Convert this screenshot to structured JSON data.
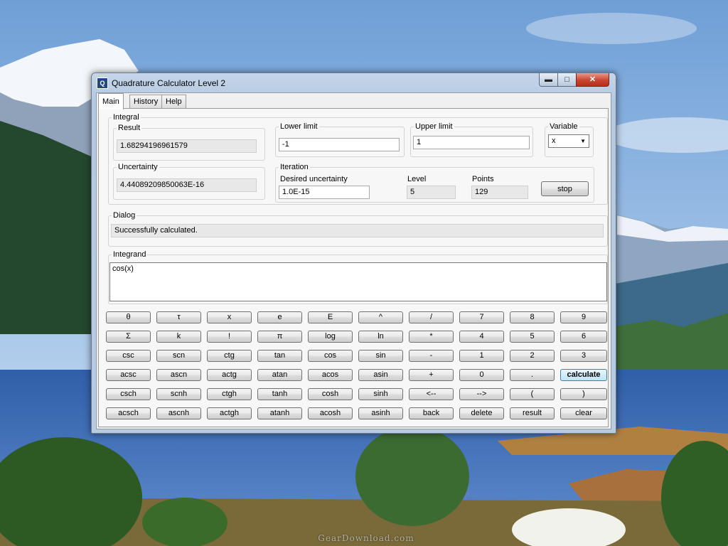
{
  "window": {
    "title": "Quadrature Calculator Level 2",
    "icon": "calculator-app-icon",
    "controls": {
      "minimize": "minimize-icon",
      "maximize": "maximize-icon",
      "close": "close-icon"
    }
  },
  "tabs": [
    {
      "label": "Main",
      "active": true
    },
    {
      "label": "History",
      "active": false
    },
    {
      "label": "Help",
      "active": false
    }
  ],
  "integral": {
    "group_label": "Integral",
    "result_label": "Result",
    "result_value": "1.68294196961579",
    "uncertainty_label": "Uncertainty",
    "uncertainty_value": "4.44089209850063E-16",
    "lower_label": "Lower limit",
    "lower_value": "-1",
    "upper_label": "Upper limit",
    "upper_value": "1",
    "variable_label": "Variable",
    "variable_value": "x",
    "iteration": {
      "group_label": "Iteration",
      "desired_label": "Desired uncertainty",
      "desired_value": "1.0E-15",
      "level_label": "Level",
      "level_value": "5",
      "points_label": "Points",
      "points_value": "129",
      "stop_label": "stop"
    }
  },
  "dialog": {
    "group_label": "Dialog",
    "message": "Successfully calculated."
  },
  "integrand": {
    "group_label": "Integrand",
    "value": "cos(x)"
  },
  "keypad": [
    [
      "θ",
      "τ",
      "x",
      "e",
      "E",
      "^",
      "/",
      "7",
      "8",
      "9"
    ],
    [
      "Σ",
      "k",
      "!",
      "π",
      "log",
      "ln",
      "*",
      "4",
      "5",
      "6"
    ],
    [
      "csc",
      "scn",
      "ctg",
      "tan",
      "cos",
      "sin",
      "-",
      "1",
      "2",
      "3"
    ],
    [
      "acsc",
      "ascn",
      "actg",
      "atan",
      "acos",
      "asin",
      "+",
      "0",
      ".",
      "calculate"
    ],
    [
      "csch",
      "scnh",
      "ctgh",
      "tanh",
      "cosh",
      "sinh",
      "<--",
      "-->",
      "(",
      ")"
    ],
    [
      "acsch",
      "ascnh",
      "actgh",
      "atanh",
      "acosh",
      "asinh",
      "back",
      "delete",
      "result",
      "clear"
    ]
  ],
  "colors": {
    "accent_button": "#bee4f8",
    "close_button": "#c9452f",
    "window_frame": "#b9cbe1"
  },
  "watermark": "GearDownload.com"
}
